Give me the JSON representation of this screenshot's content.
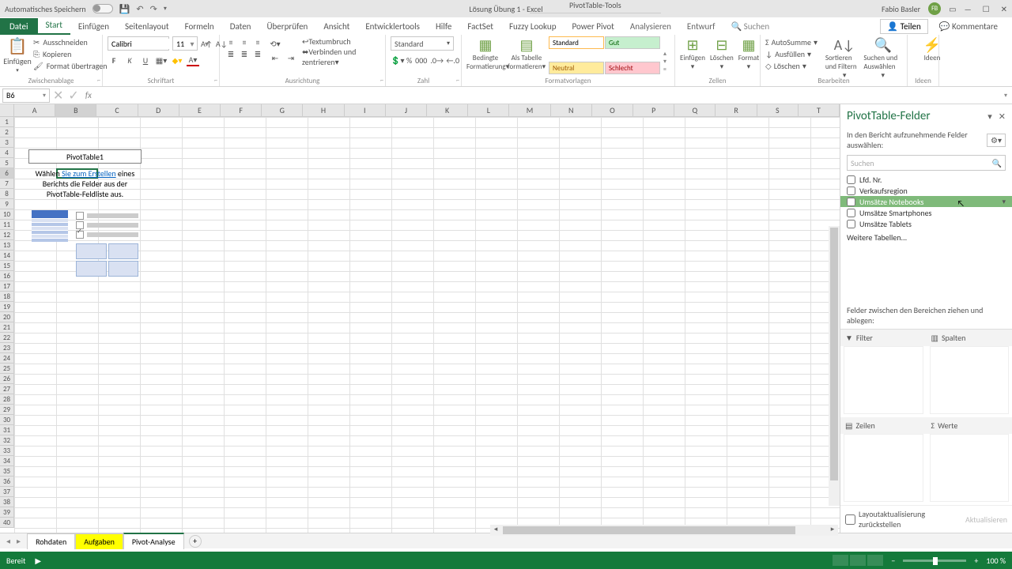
{
  "title_bar": {
    "autosave": "Automatisches Speichern",
    "doc": "Lösung Übung 1 - Excel",
    "tool_context": "PivotTable-Tools",
    "user": "Fabio Basler",
    "badge": "FB"
  },
  "tabs": {
    "file": "Datei",
    "start": "Start",
    "einf": "Einfügen",
    "seite": "Seitenlayout",
    "formeln": "Formeln",
    "daten": "Daten",
    "uberp": "Überprüfen",
    "ansicht": "Ansicht",
    "entw": "Entwicklertools",
    "hilfe": "Hilfe",
    "factset": "FactSet",
    "fuzzy": "Fuzzy Lookup",
    "powerp": "Power Pivot",
    "analyse": "Analysieren",
    "entwurf": "Entwurf",
    "search": "Suchen",
    "teilen": "Teilen",
    "kommentare": "Kommentare"
  },
  "ribbon": {
    "clip": {
      "paste": "Einfügen",
      "cut": "Ausschneiden",
      "copy": "Kopieren",
      "fmt": "Format übertragen",
      "label": "Zwischenablage"
    },
    "font": {
      "name": "Calibri",
      "size": "11",
      "label": "Schriftart"
    },
    "align": {
      "wrap": "Textumbruch",
      "merge": "Verbinden und zentrieren",
      "label": "Ausrichtung"
    },
    "number": {
      "fmt": "Standard",
      "label": "Zahl"
    },
    "styles": {
      "cond": "Bedingte Formatierung",
      "table": "Als Tabelle formatieren",
      "std": "Standard",
      "gut": "Gut",
      "neu": "Neutral",
      "sch": "Schlecht",
      "label": "Formatvorlagen"
    },
    "cells": {
      "ins": "Einfügen",
      "del": "Löschen",
      "fmt": "Format",
      "label": "Zellen"
    },
    "edit": {
      "sum": "AutoSumme",
      "fill": "Ausfüllen",
      "clear": "Löschen",
      "sort": "Sortieren und Filtern",
      "find": "Suchen und Auswählen",
      "label": "Bearbeiten"
    },
    "ideas": {
      "label": "Ideen"
    }
  },
  "name_box": "B6",
  "cols": [
    "A",
    "B",
    "C",
    "D",
    "E",
    "F",
    "G",
    "H",
    "I",
    "J",
    "K",
    "L",
    "M",
    "N",
    "O",
    "P",
    "Q",
    "R",
    "S",
    "T"
  ],
  "pivot_ph": {
    "title": "PivotTable1",
    "l1": "Wählen ",
    "link": "Sie zum Erstellen",
    "l2": " eines Berichts die Felder aus der PivotTable-Feldliste aus."
  },
  "pane": {
    "title": "PivotTable-Felder",
    "sub": "In den Bericht aufzunehmende Felder auswählen:",
    "search": "Suchen",
    "fields": {
      "f0": "Lfd. Nr.",
      "f1": "Verkaufsregion",
      "f2": "Umsätze Notebooks",
      "f3": "Umsätze Smartphones",
      "f4": "Umsätze Tablets"
    },
    "more": "Weitere Tabellen...",
    "areas_hint": "Felder zwischen den Bereichen ziehen und ablegen:",
    "filter": "Filter",
    "spalten": "Spalten",
    "zeilen": "Zeilen",
    "werte": "Werte",
    "defer": "Layoutaktualisierung zurückstellen",
    "update": "Aktualisieren"
  },
  "sheets": {
    "s0": "Rohdaten",
    "s1": "Aufgaben",
    "s2": "Pivot-Analyse"
  },
  "status": {
    "ready": "Bereit",
    "zoom": "100 %"
  }
}
